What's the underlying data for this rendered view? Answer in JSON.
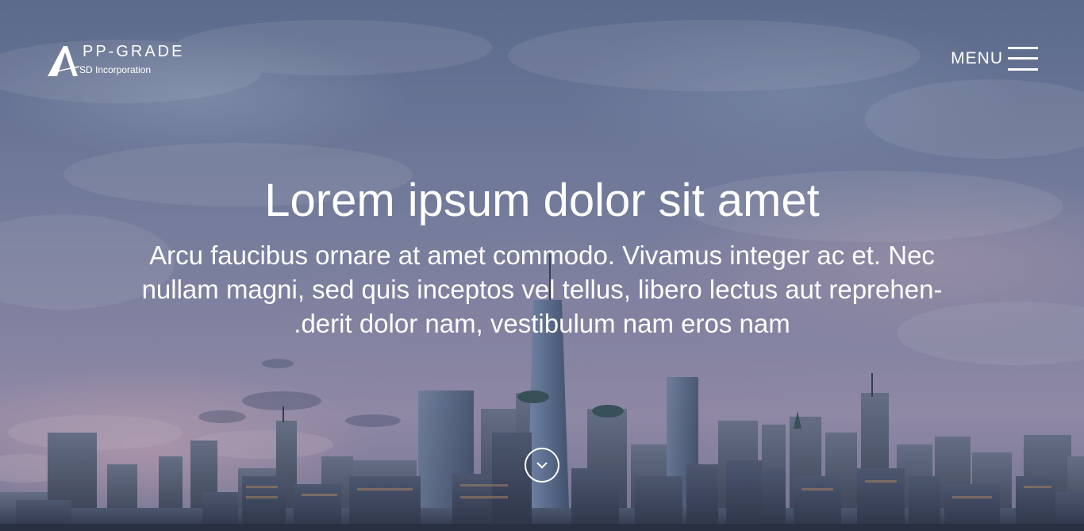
{
  "brand": {
    "name": "PP-GRADE",
    "mark_letter": "A",
    "subtitle": "SD Incorporation"
  },
  "nav": {
    "menu_label": "MENU",
    "menu_icon": "hamburger-icon"
  },
  "hero": {
    "title": "Lorem ipsum dolor sit amet",
    "subtitle": "Arcu faucibus ornare at amet commodo. Vivamus integer ac et. Nec nullam magni, sed quis inceptos vel tellus, libero lectus aut reprehen- .derit dolor nam, vestibulum nam eros nam",
    "scroll_icon": "chevron-down-icon"
  },
  "colors": {
    "text": "#ffffff",
    "sky_top": "#6f7fa0",
    "sky_bottom": "#b8a9c4"
  }
}
